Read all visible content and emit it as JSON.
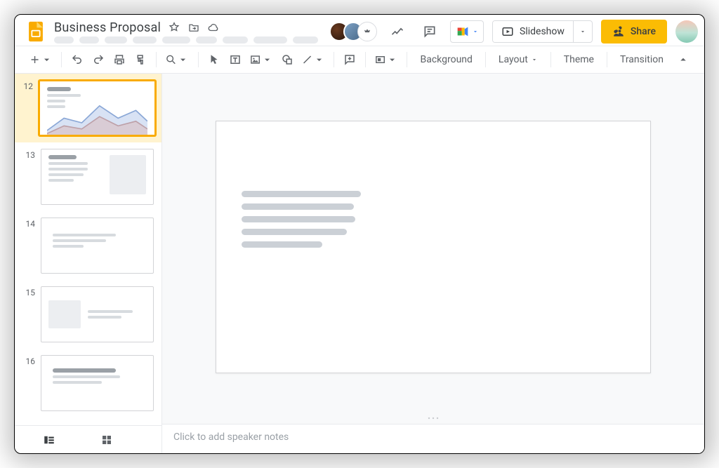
{
  "doc_title": "Business Proposal",
  "slideshow_label": "Slideshow",
  "share_label": "Share",
  "toolbar_text": {
    "background": "Background",
    "layout": "Layout",
    "theme": "Theme",
    "transition": "Transition"
  },
  "thumbs": [
    {
      "num": "12"
    },
    {
      "num": "13"
    },
    {
      "num": "14"
    },
    {
      "num": "15"
    },
    {
      "num": "16"
    }
  ],
  "speaker_notes_placeholder": "Click to add speaker notes"
}
